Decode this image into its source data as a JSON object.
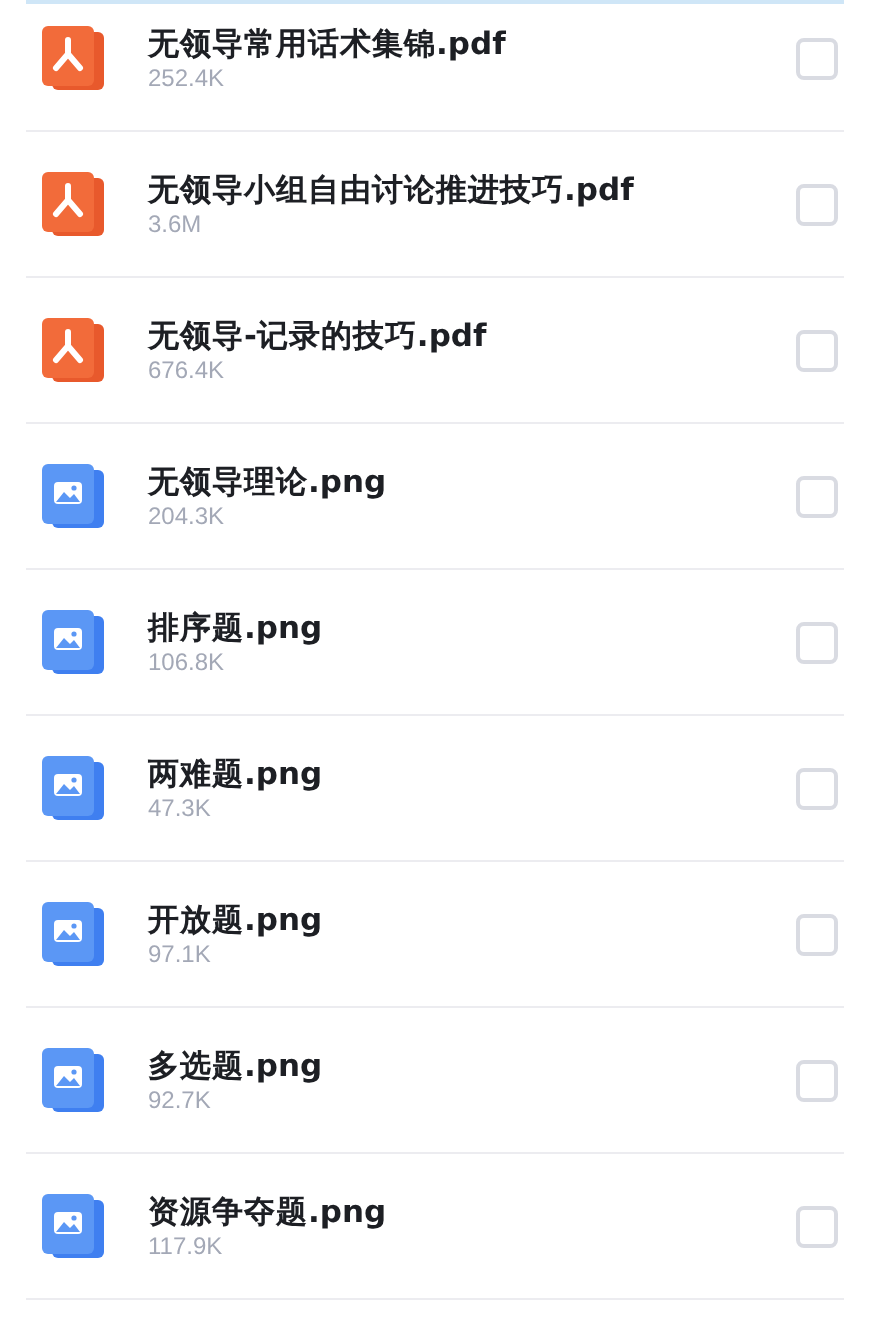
{
  "files": [
    {
      "kind": "pdf",
      "name": "无领导常用话术集锦.pdf",
      "size": "252.4K",
      "checked": false
    },
    {
      "kind": "pdf",
      "name": "无领导小组自由讨论推进技巧.pdf",
      "size": "3.6M",
      "checked": false
    },
    {
      "kind": "pdf",
      "name": "无领导-记录的技巧.pdf",
      "size": "676.4K",
      "checked": false
    },
    {
      "kind": "image",
      "name": "无领导理论.png",
      "size": "204.3K",
      "checked": false
    },
    {
      "kind": "image",
      "name": "排序题.png",
      "size": "106.8K",
      "checked": false
    },
    {
      "kind": "image",
      "name": "两难题.png",
      "size": "47.3K",
      "checked": false
    },
    {
      "kind": "image",
      "name": "开放题.png",
      "size": "97.1K",
      "checked": false
    },
    {
      "kind": "image",
      "name": "多选题.png",
      "size": "92.7K",
      "checked": false
    },
    {
      "kind": "image",
      "name": "资源争夺题.png",
      "size": "117.9K",
      "checked": false
    }
  ]
}
